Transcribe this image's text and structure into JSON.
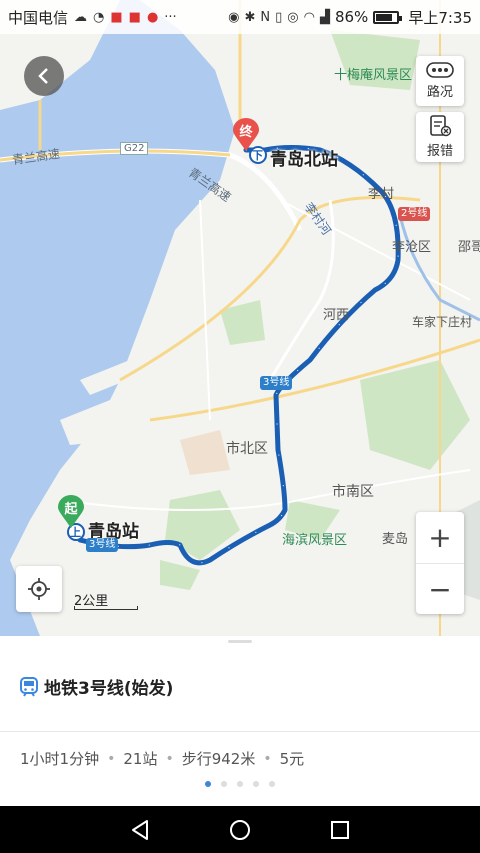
{
  "status_bar": {
    "carrier": "中国电信",
    "battery": "86%",
    "time": "早上7:35"
  },
  "map": {
    "labels": {
      "qingdao_north": "青岛北站",
      "qingdao_station": "青岛站",
      "shimeian": "十梅庵风景区",
      "licun": "李村",
      "licang": "李沧区",
      "shao": "邵哥",
      "chejia": "车家下庄村",
      "hexi": "河西",
      "shibei": "市北区",
      "shinan": "市南区",
      "haibin": "海滨风景区",
      "maidao": "麦岛",
      "qinglan": "青兰高速",
      "qinglan2": "青兰高速",
      "g22": "G22",
      "licunhe": "李村河"
    },
    "line_badges": {
      "line3_mid": "3号线",
      "line3_start": "3号线",
      "line2": "2号线"
    },
    "pins": {
      "end": "终",
      "start": "起"
    },
    "transfer_marks": {
      "north": "下",
      "start": "上"
    },
    "buttons": {
      "traffic": "路况",
      "report": "报错"
    },
    "scale": "2公里",
    "colors": {
      "route": "#1a5fb4",
      "water": "#aecbef",
      "land": "#f3f3ef",
      "green": "#cfe6c4"
    }
  },
  "sheet": {
    "title": "地铁3号线(始发)",
    "info": {
      "duration": "1小时1分钟",
      "stops": "21站",
      "walk": "步行942米",
      "fare": "5元"
    },
    "pages": 5,
    "active_page": 0
  }
}
